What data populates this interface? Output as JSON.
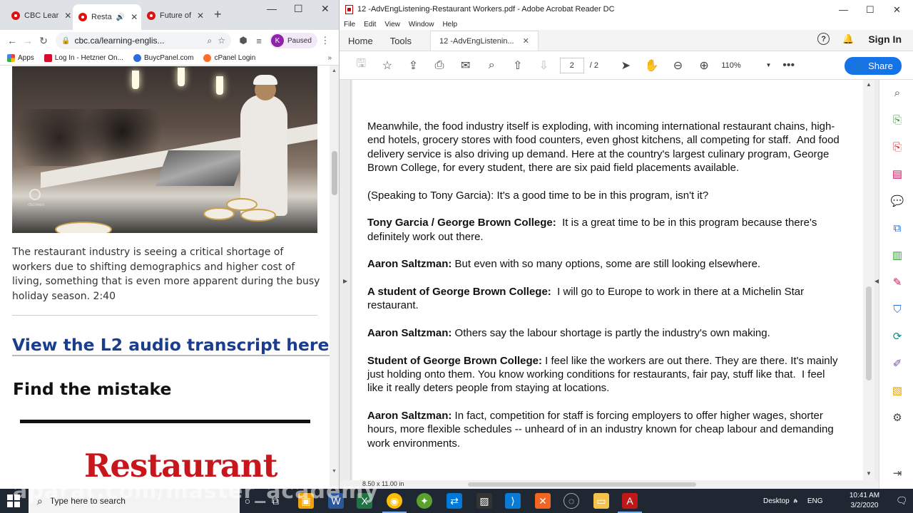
{
  "chrome": {
    "tabs": [
      {
        "label": "CBC Lear",
        "active": false
      },
      {
        "label": "Resta",
        "active": true
      },
      {
        "label": "Future of",
        "active": false
      }
    ],
    "address": "cbc.ca/learning-englis...",
    "profile_initial": "K",
    "profile_status": "Paused",
    "bookmarks": [
      {
        "label": "Apps",
        "icon": "apps-grid-icon",
        "color": "#e8453c"
      },
      {
        "label": "Log In - Hetzner On...",
        "icon": "hetzner-icon",
        "color": "#d50c2d"
      },
      {
        "label": "BuycPanel.com",
        "icon": "buycpanel-icon",
        "color": "#2a6dd9"
      },
      {
        "label": "cPanel Login",
        "icon": "cpanel-icon",
        "color": "#ff6c2c"
      }
    ]
  },
  "article": {
    "image_watermark": "cbcnews",
    "caption": "The restaurant industry is seeing a critical shortage of workers due to shifting demographics and higher cost of living, something that is even more apparent during the busy holiday season. 2:40",
    "transcript_link": "View the L2 audio transcript here.",
    "find_heading": "Find the mistake",
    "restaurant_word": "Restaurant"
  },
  "acrobat": {
    "window_title": "12 -AdvEngListening-Restaurant Workers.pdf - Adobe Acrobat Reader DC",
    "menu": [
      "File",
      "Edit",
      "View",
      "Window",
      "Help"
    ],
    "tabs": {
      "home": "Home",
      "tools": "Tools",
      "doc": "12 -AdvEngListenin..."
    },
    "sign_in": "Sign In",
    "share": "Share",
    "page_current": "2",
    "page_total": "/ 2",
    "zoom": "110%",
    "status_size": "8.50 x 11.00 in",
    "accent": "#1473e6"
  },
  "pdf": {
    "paragraphs": [
      {
        "speaker": "",
        "text": "Meanwhile, the food industry itself is exploding, with incoming international restaurant chains, high-end hotels, grocery stores with food counters, even ghost kitchens, all competing for staff.  And food delivery service is also driving up demand. Here at the country's largest culinary program, George Brown College, for every student, there are six paid field placements available."
      },
      {
        "speaker": "",
        "text": "(Speaking to Tony Garcia): It's a good time to be in this program, isn't it?"
      },
      {
        "speaker": "Tony Garcia / George Brown College:",
        "text": "  It is a great time to be in this program because there's definitely work out there."
      },
      {
        "speaker": "Aaron Saltzman:",
        "text": " But even with so many options, some are still looking elsewhere."
      },
      {
        "speaker": "A student of George Brown College:",
        "text": "  I will go to Europe to work in there at a Michelin Star restaurant."
      },
      {
        "speaker": "Aaron Saltzman:",
        "text": " Others say the labour shortage is partly the industry's own making."
      },
      {
        "speaker": "Student of George Brown College:",
        "text": " I feel like the workers are out there. They are there. It's mainly just holding onto them. You know working conditions for restaurants, fair pay, stuff like that.  I feel like it really deters people from staying at locations."
      },
      {
        "speaker": "Aaron Saltzman:",
        "text": " In fact, competition for staff is forcing employers to offer higher wages, shorter hours, more flexible schedules -- unheard of in an industry known for cheap labour and demanding work environments."
      }
    ]
  },
  "taskbar": {
    "search_placeholder": "Type here to search",
    "desktop_label": "Desktop",
    "lang": "ENG",
    "time": "10:41 AM",
    "date": "3/2/2020"
  },
  "overlay": {
    "watermark": "aparat.com/master_academy"
  }
}
